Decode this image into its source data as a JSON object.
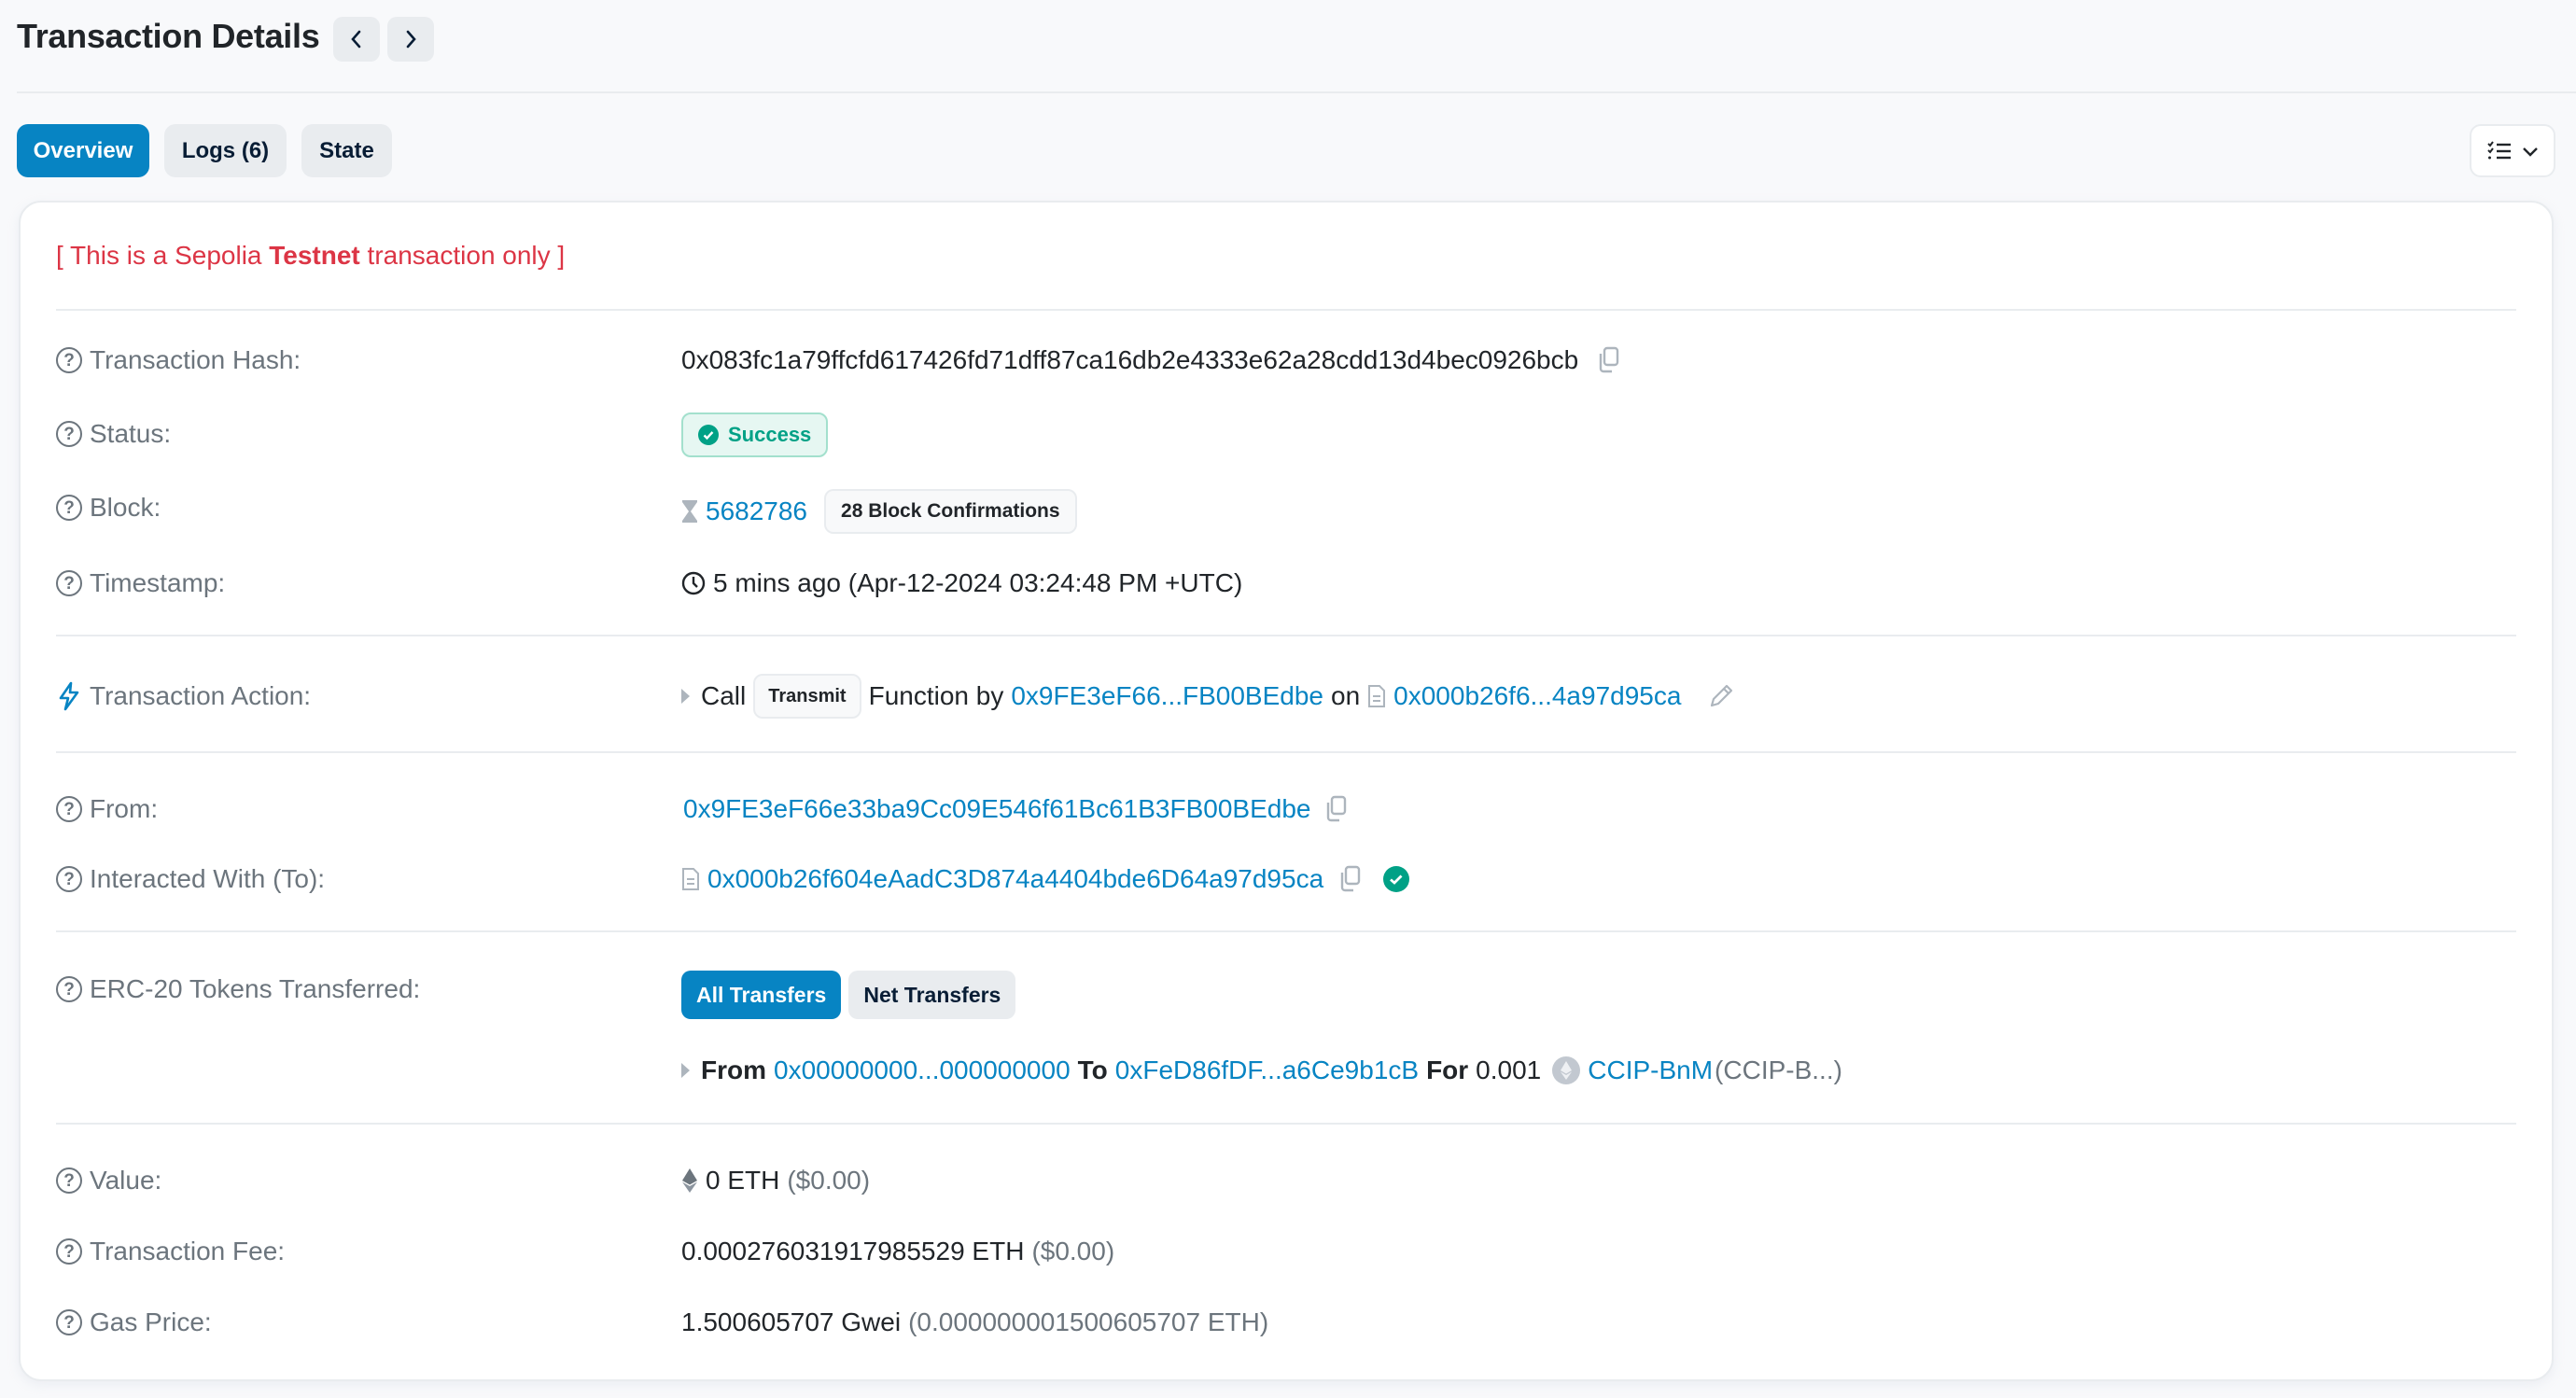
{
  "header": {
    "title": "Transaction Details",
    "prev_icon": "chevron-left-icon",
    "next_icon": "chevron-right-icon"
  },
  "tabs": [
    {
      "label": "Overview",
      "active": true
    },
    {
      "label": "Logs (6)",
      "active": false
    },
    {
      "label": "State",
      "active": false
    }
  ],
  "view_menu": {
    "icon": "checklist-icon",
    "caret": "chevron-down-icon"
  },
  "testnet_notice": {
    "prefix": "[ This is a Sepolia ",
    "bold": "Testnet",
    "suffix": " transaction only ]"
  },
  "rows": {
    "hash": {
      "label": "Transaction Hash:",
      "value": "0x083fc1a79ffcfd617426fd71dff87ca16db2e4333e62a28cdd13d4bec0926bcb"
    },
    "status": {
      "label": "Status:",
      "value": "Success"
    },
    "block": {
      "label": "Block:",
      "value": "5682786",
      "confirmations": "28 Block Confirmations"
    },
    "timestamp": {
      "label": "Timestamp:",
      "value": "5 mins ago (Apr-12-2024 03:24:48 PM +UTC)"
    },
    "action": {
      "label": "Transaction Action:",
      "call": "Call",
      "method": "Transmit",
      "function_by": "Function by",
      "from_short": "0x9FE3eF66...FB00BEdbe",
      "on": "on",
      "contract_short": "0x000b26f6...4a97d95ca"
    },
    "from": {
      "label": "From:",
      "value": "0x9FE3eF66e33ba9Cc09E546f61Bc61B3FB00BEdbe"
    },
    "to": {
      "label": "Interacted With (To):",
      "value": "0x000b26f604eAadC3D874a4404bde6D64a97d95ca"
    },
    "erc20": {
      "label": "ERC-20 Tokens Transferred:",
      "filters": [
        {
          "label": "All Transfers",
          "active": true
        },
        {
          "label": "Net Transfers",
          "active": false
        }
      ],
      "transfer": {
        "from_label": "From",
        "from": "0x00000000...000000000",
        "to_label": "To",
        "to": "0xFeD86fDF...a6Ce9b1cB",
        "for_label": "For",
        "amount": "0.001",
        "token": "CCIP-BnM",
        "token_symbol": "(CCIP-B...)"
      }
    },
    "value": {
      "label": "Value:",
      "amount": "0 ETH",
      "usd": "($0.00)"
    },
    "fee": {
      "label": "Transaction Fee:",
      "amount": "0.000276031917985529 ETH",
      "usd": "($0.00)"
    },
    "gas": {
      "label": "Gas Price:",
      "amount": "1.500605707 Gwei",
      "eth": "(0.000000001500605707 ETH)"
    }
  },
  "colors": {
    "accent": "#0784c3",
    "success": "#00a186",
    "danger": "#dc3545",
    "muted": "#6c757d"
  }
}
